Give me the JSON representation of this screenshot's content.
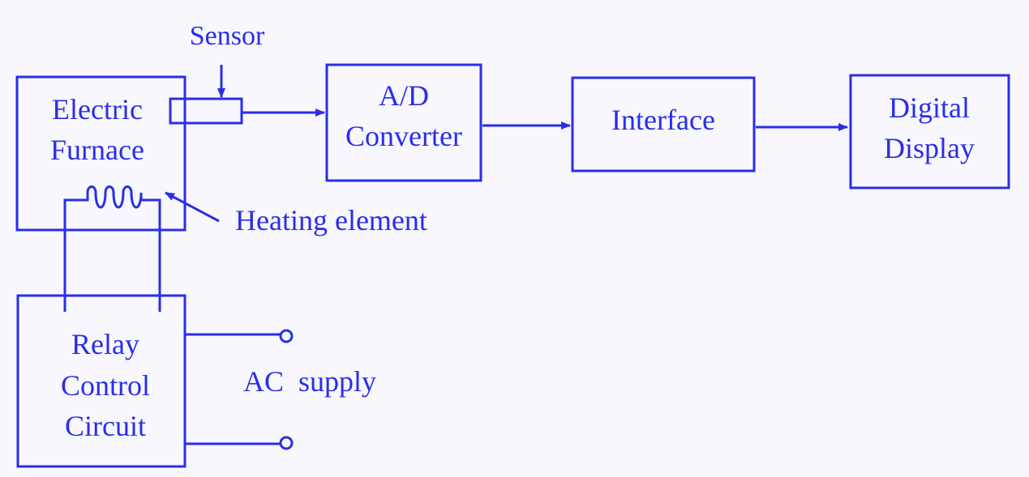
{
  "colors": {
    "ink": "#2a2ee8",
    "background": "#f7f7fd"
  },
  "blocks": {
    "furnace": {
      "lines": [
        "Electric",
        "Furnace"
      ]
    },
    "adc": {
      "lines": [
        "A/D",
        "Converter"
      ]
    },
    "interface": {
      "lines": [
        "Interface"
      ]
    },
    "display": {
      "lines": [
        "Digital",
        "Display"
      ]
    },
    "relay": {
      "lines": [
        "Relay",
        "Control",
        "Circuit"
      ]
    }
  },
  "labels": {
    "sensor": "Sensor",
    "heating_element": "Heating element",
    "ac_supply": "AC  supply"
  },
  "connections": [
    {
      "from": "Sensor",
      "to": "A/D Converter"
    },
    {
      "from": "A/D Converter",
      "to": "Interface"
    },
    {
      "from": "Interface",
      "to": "Digital Display"
    },
    {
      "from": "Relay Control Circuit",
      "to": "Heating element"
    },
    {
      "from": "AC supply",
      "to": "Relay Control Circuit"
    }
  ]
}
